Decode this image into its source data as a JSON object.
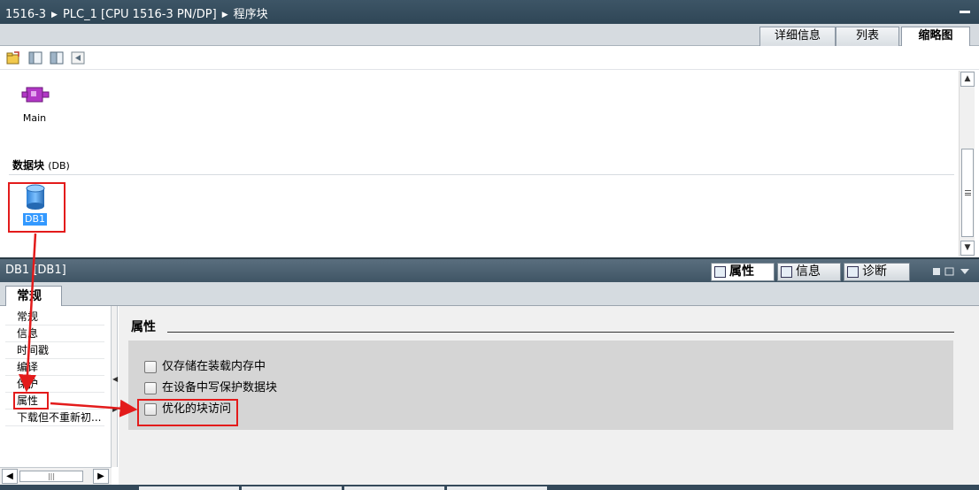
{
  "breadcrumb": [
    "1516-3",
    "PLC_1 [CPU 1516-3 PN/DP]",
    "程序块"
  ],
  "view_tabs": [
    {
      "label": "详细信息",
      "active": false
    },
    {
      "label": "列表",
      "active": false
    },
    {
      "label": "缩略图",
      "active": true
    }
  ],
  "toolbar": {
    "icons": [
      "open-folder-icon",
      "split-vertical-icon",
      "split-horizontal-icon",
      "back-icon"
    ]
  },
  "overview": {
    "main_block_label": "Main",
    "section_title": "数据块",
    "section_suffix": "(DB)",
    "db_item_label": "DB1"
  },
  "inspector": {
    "title": "DB1 [DB1]",
    "tabs": [
      {
        "label": "属性",
        "active": true
      },
      {
        "label": "信息",
        "active": false
      },
      {
        "label": "诊断",
        "active": false
      }
    ],
    "subtab": "常规",
    "nav_items": [
      "常规",
      "信息",
      "时间戳",
      "编译",
      "保护",
      "属性",
      "下载但不重新初..."
    ],
    "group_title": "属性",
    "checkboxes": [
      {
        "label": "仅存储在装载内存中",
        "checked": false
      },
      {
        "label": "在设备中写保护数据块",
        "checked": false
      },
      {
        "label": "优化的块访问",
        "checked": false
      }
    ]
  },
  "colors": {
    "annotation": "#e31b1b",
    "selection": "#3399ff",
    "header": "#3d5566"
  }
}
